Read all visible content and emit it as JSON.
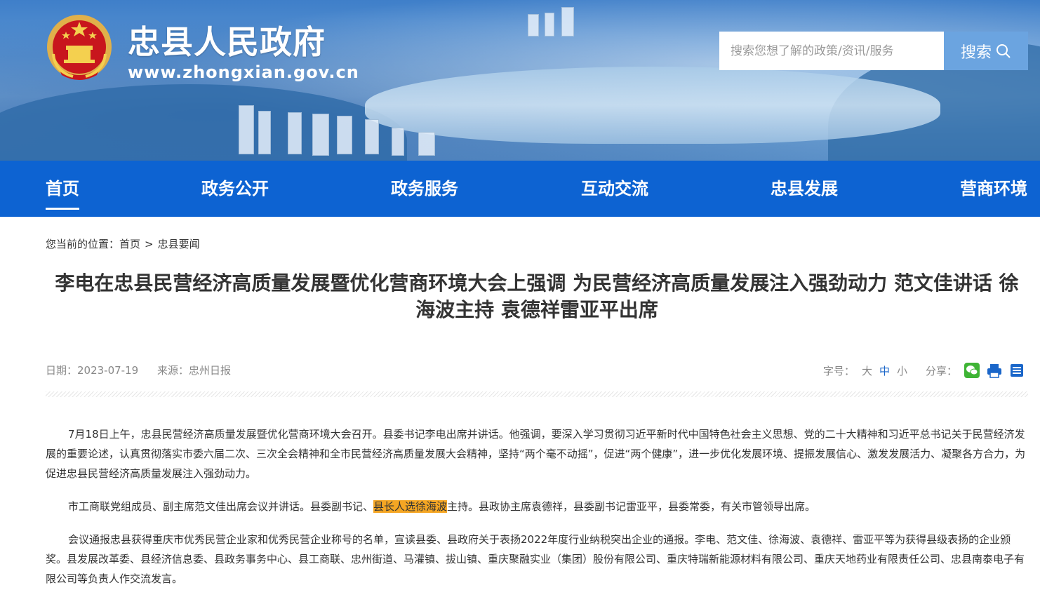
{
  "header": {
    "site_title": "忠县人民政府",
    "site_url": "www.zhongxian.gov.cn",
    "search_placeholder": "搜索您想了解的政策/资讯/服务",
    "search_button": "搜索"
  },
  "nav": {
    "items": [
      {
        "label": "首页",
        "active": true
      },
      {
        "label": "政务公开"
      },
      {
        "label": "政务服务"
      },
      {
        "label": "互动交流"
      },
      {
        "label": "忠县发展"
      },
      {
        "label": "营商环境"
      }
    ]
  },
  "breadcrumb": {
    "prefix": "您当前的位置：",
    "home": "首页",
    "separator": ">",
    "current": "忠县要闻"
  },
  "article": {
    "title": "李电在忠县民营经济高质量发展暨优化营商环境大会上强调 为民营经济高质量发展注入强劲动力 范文佳讲话 徐海波主持 袁德祥雷亚平出席",
    "date": "日期：2023-07-19",
    "source": "来源：忠州日报",
    "font_size_label": "字号：",
    "font_large": "大",
    "font_medium": "中",
    "font_small": "小",
    "share_label": "分享：",
    "paragraphs": [
      "7月18日上午，忠县民营经济高质量发展暨优化营商环境大会召开。县委书记李电出席并讲话。他强调，要深入学习贯彻习近平新时代中国特色社会主义思想、党的二十大精神和习近平总书记关于民营经济发展的重要论述，认真贯彻落实市委六届二次、三次全会精神和全市民营经济高质量发展大会精神，坚持“两个毫不动摇”，促进“两个健康”，进一步优化发展环境、提振发展信心、激发发展活力、凝聚各方合力，为促进忠县民营经济高质量发展注入强劲动力。",
      "会议通报忠县获得重庆市优秀民营企业家和优秀民营企业称号的名单，宣读县委、县政府关于表扬2022年度行业纳税突出企业的通报。李电、范文佳、徐海波、袁德祥、雷亚平等为获得县级表扬的企业颁奖。县发展改革委、县经济信息委、县政务事务中心、县工商联、忠州街道、马灌镇、拔山镇、重庆聚融实业（集团）股份有限公司、重庆特瑞新能源材料有限公司、重庆天地药业有限责任公司、忠县南泰电子有限公司等负责人作交流发言。"
    ],
    "para2_before": "市工商联党组成员、副主席范文佳出席会议并讲话。县委副书记、",
    "para2_highlight": "县长人选徐海波",
    "para2_after": "主持。县政协主席袁德祥，县委副书记雷亚平，县委常委，有关市管领导出席。"
  },
  "colors": {
    "nav_bg": "#0d63d2",
    "search_btn": "#6ba4e0",
    "highlight": "#f5a623",
    "wechat": "#3fb435",
    "icon_blue": "#1a66c9"
  }
}
